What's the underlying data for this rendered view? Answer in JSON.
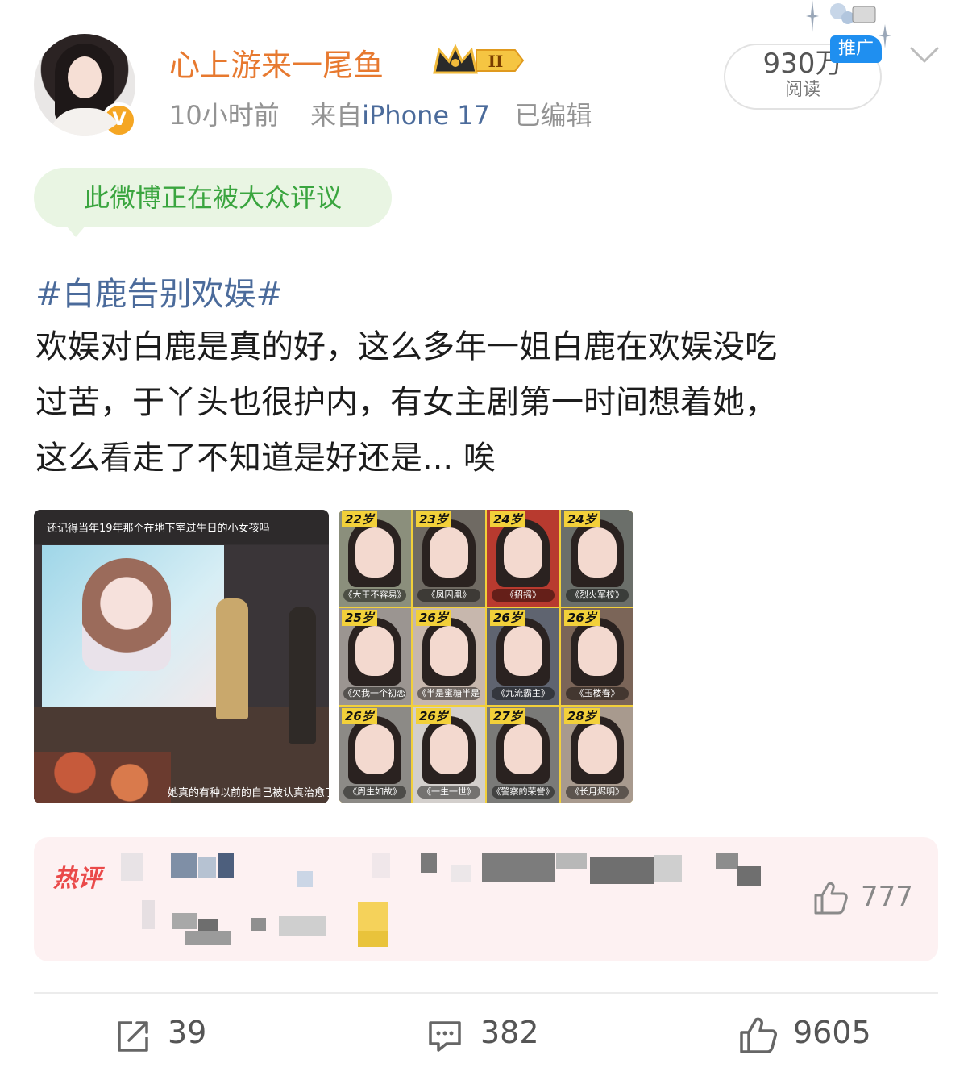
{
  "post": {
    "author": "心上游来一尾鱼",
    "level_badge": "II",
    "time": "10小时前",
    "source_prefix": "来自",
    "source": "iPhone 17",
    "edited": "已编辑",
    "reads_value": "930万",
    "reads_label": "阅读",
    "promo_label": "推广",
    "discussion_note": "此微博正在被大众评议",
    "topic": "#白鹿告别欢娱#",
    "text_lines": [
      "欢娱对白鹿是真的好，这么多年一姐白鹿在欢娱没吃",
      "过苦，于丫头也很护内，有女主剧第一时间想着她，",
      "这么看走了不知道是好还是... 唉"
    ]
  },
  "image1": {
    "caption_top": "还记得当年19年那个在地下室过生日的小女孩吗",
    "caption_bottom": "她真的有种以前的自己被认真治愈了"
  },
  "image2": {
    "tiles": [
      {
        "age": "22岁",
        "title": "《大王不容易》",
        "bg": "#8b8f7c"
      },
      {
        "age": "23岁",
        "title": "《凤囚凰》",
        "bg": "#6f6a63"
      },
      {
        "age": "24岁",
        "title": "《招摇》",
        "bg": "#b83a2f"
      },
      {
        "age": "24岁",
        "title": "《烈火军校》",
        "bg": "#6b6f6a"
      },
      {
        "age": "25岁",
        "title": "《欠我一个初恋》",
        "bg": "#9b9591"
      },
      {
        "age": "26岁",
        "title": "《半是蜜糖半是伤》",
        "bg": "#c7b7ad"
      },
      {
        "age": "26岁",
        "title": "《九流霸主》",
        "bg": "#5f6470"
      },
      {
        "age": "26岁",
        "title": "《玉楼春》",
        "bg": "#7b6558"
      },
      {
        "age": "26岁",
        "title": "《周生如故》",
        "bg": "#8c8a86"
      },
      {
        "age": "26岁",
        "title": "《一生一世》",
        "bg": "#d3cfcc"
      },
      {
        "age": "27岁",
        "title": "《警察的荣誉》",
        "bg": "#7a7a78"
      },
      {
        "age": "28岁",
        "title": "《长月烬明》",
        "bg": "#a89a8e"
      }
    ]
  },
  "hot_comment": {
    "label": "热评",
    "likes": "777"
  },
  "actions": {
    "reposts": "39",
    "comments": "382",
    "likes": "9605"
  },
  "colors": {
    "username": "#e7792f",
    "link": "#4b6b9b",
    "discussion_text": "#3aa53f",
    "hot_label": "#ea4a4a"
  },
  "icons": [
    "verified-icon",
    "crown-level-icon",
    "chevron-down-icon",
    "thumbs-up-icon",
    "repost-icon",
    "comment-icon"
  ]
}
